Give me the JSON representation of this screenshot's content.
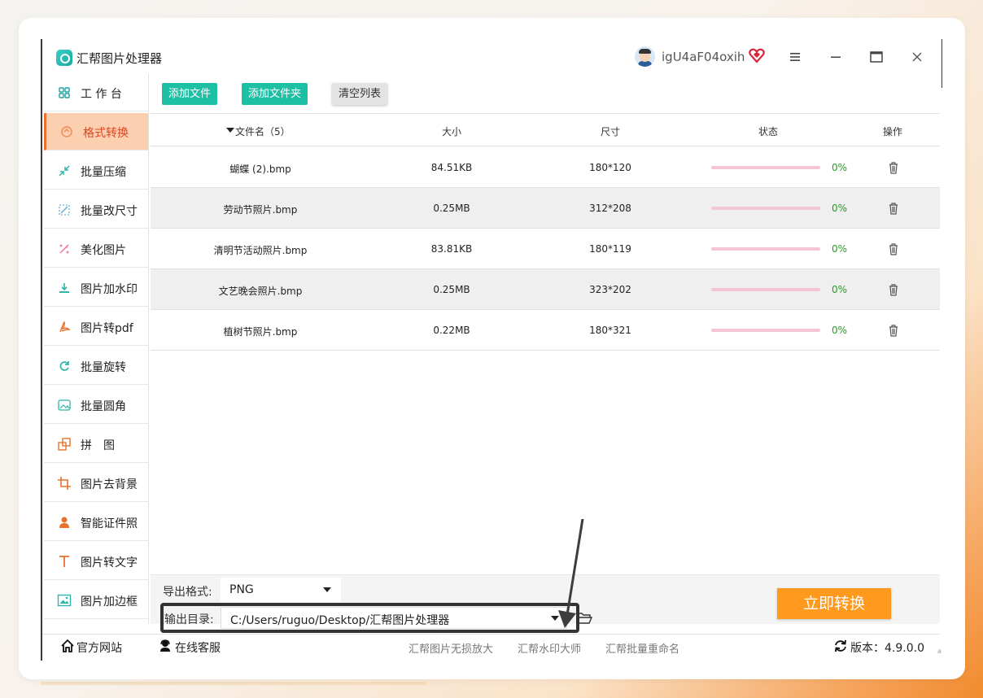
{
  "app": {
    "title": "汇帮图片处理器",
    "username": "igU4aF04oxih",
    "version_label": "版本：4.9.0.0"
  },
  "icons": {
    "logo": "app-logo-icon",
    "vip": "heart-diamond-icon",
    "menu": "hamburger-menu-icon",
    "minimize": "minimize-icon",
    "maximize": "maximize-icon",
    "close": "close-icon"
  },
  "sidebar": {
    "items": [
      {
        "label": "工 作 台",
        "icon": "grid-icon",
        "active": false
      },
      {
        "label": "格式转换",
        "icon": "convert-icon",
        "active": true
      },
      {
        "label": "批量压缩",
        "icon": "compress-icon",
        "active": false
      },
      {
        "label": "批量改尺寸",
        "icon": "resize-icon",
        "active": false
      },
      {
        "label": "美化图片",
        "icon": "beautify-icon",
        "active": false
      },
      {
        "label": "图片加水印",
        "icon": "watermark-icon",
        "active": false
      },
      {
        "label": "图片转pdf",
        "icon": "pdf-icon",
        "active": false
      },
      {
        "label": "批量旋转",
        "icon": "rotate-icon",
        "active": false
      },
      {
        "label": "批量圆角",
        "icon": "round-corner-icon",
        "active": false
      },
      {
        "label": "拼　图",
        "icon": "puzzle-icon",
        "active": false
      },
      {
        "label": "图片去背景",
        "icon": "crop-icon",
        "active": false
      },
      {
        "label": "智能证件照",
        "icon": "id-photo-icon",
        "active": false
      },
      {
        "label": "图片转文字",
        "icon": "text-icon",
        "active": false
      },
      {
        "label": "图片加边框",
        "icon": "frame-icon",
        "active": false
      }
    ]
  },
  "toolbar": {
    "add_file": "添加文件",
    "add_folder": "添加文件夹",
    "clear_list": "清空列表"
  },
  "table": {
    "headers": {
      "filename": "文件名（5）",
      "size": "大小",
      "dimensions": "尺寸",
      "status": "状态",
      "action": "操作"
    },
    "rows": [
      {
        "name": "蝴蝶 (2).bmp",
        "size": "84.51KB",
        "dims": "180*120",
        "progress": "0%"
      },
      {
        "name": "劳动节照片.bmp",
        "size": "0.25MB",
        "dims": "312*208",
        "progress": "0%"
      },
      {
        "name": "清明节活动照片.bmp",
        "size": "83.81KB",
        "dims": "180*119",
        "progress": "0%"
      },
      {
        "name": "文艺晚会照片.bmp",
        "size": "0.25MB",
        "dims": "323*202",
        "progress": "0%"
      },
      {
        "name": "植树节照片.bmp",
        "size": "0.22MB",
        "dims": "180*321",
        "progress": "0%"
      }
    ]
  },
  "export": {
    "format_label": "导出格式:",
    "format_value": "PNG",
    "output_label": "输出目录:",
    "output_value": "C:/Users/ruguo/Desktop/汇帮图片处理器",
    "convert_button": "立即转换"
  },
  "footer": {
    "website": "官方网站",
    "support": "在线客服",
    "links": [
      "汇帮图片无损放大",
      "汇帮水印大师",
      "汇帮批量重命名"
    ]
  },
  "colors": {
    "accent_teal": "#1ec0a5",
    "accent_orange": "#ff9a1f",
    "active_tab_bg": "#fbcfaf",
    "progress_ok": "#20a020"
  }
}
